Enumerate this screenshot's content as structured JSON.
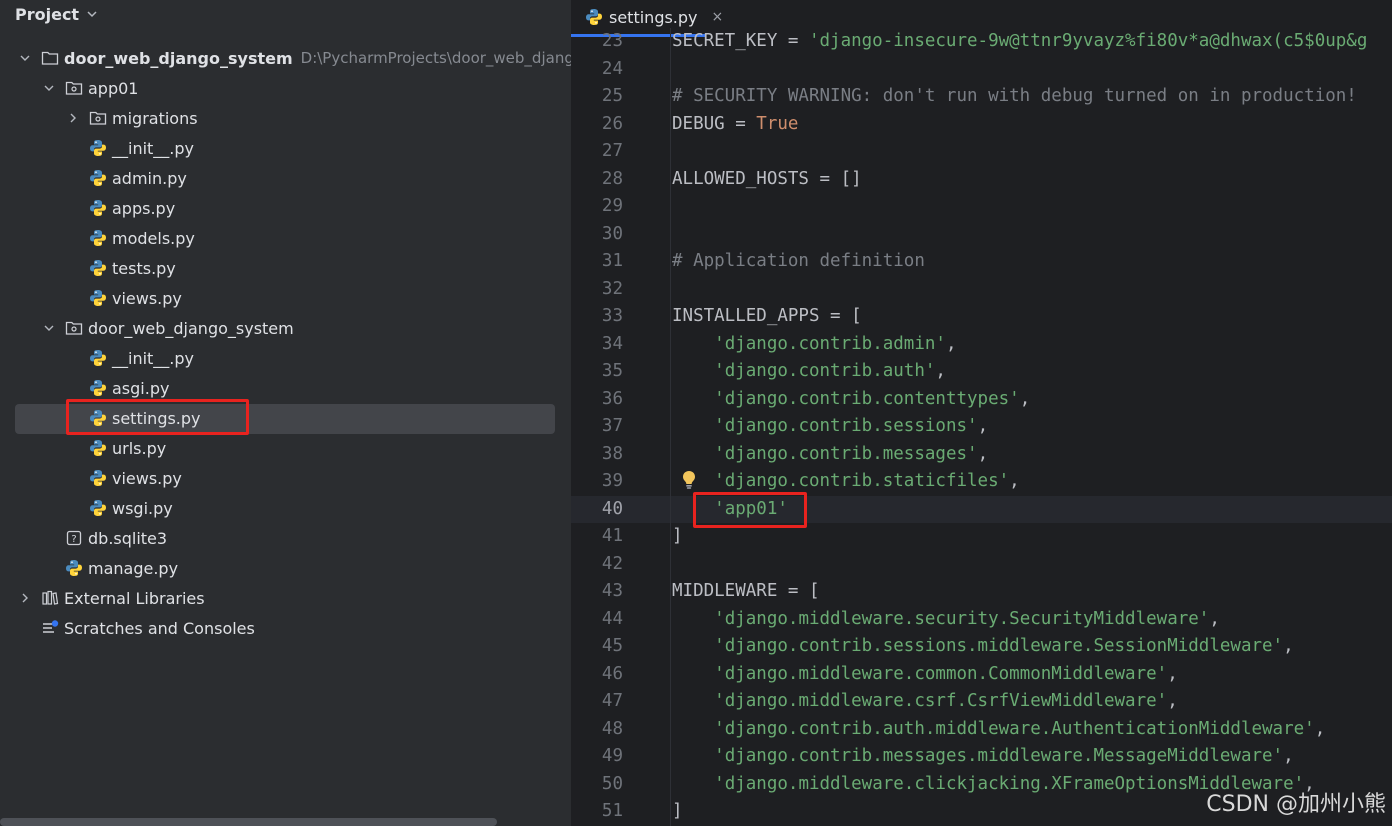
{
  "project_panel": {
    "title": "Project",
    "tree": [
      {
        "label": "door_web_django_system",
        "path": "D:\\PycharmProjects\\door_web_django",
        "icon": "folder-icon",
        "level": 0,
        "expanded": true,
        "bold": true
      },
      {
        "label": "app01",
        "icon": "package-folder-icon",
        "level": 1,
        "expanded": true
      },
      {
        "label": "migrations",
        "icon": "package-folder-icon",
        "level": 2,
        "expanded": false
      },
      {
        "label": "__init__.py",
        "icon": "python-file-icon",
        "level": 2
      },
      {
        "label": "admin.py",
        "icon": "python-file-icon",
        "level": 2
      },
      {
        "label": "apps.py",
        "icon": "python-file-icon",
        "level": 2
      },
      {
        "label": "models.py",
        "icon": "python-file-icon",
        "level": 2
      },
      {
        "label": "tests.py",
        "icon": "python-file-icon",
        "level": 2
      },
      {
        "label": "views.py",
        "icon": "python-file-icon",
        "level": 2
      },
      {
        "label": "door_web_django_system",
        "icon": "package-folder-icon",
        "level": 1,
        "expanded": true
      },
      {
        "label": "__init__.py",
        "icon": "python-file-icon",
        "level": 2
      },
      {
        "label": "asgi.py",
        "icon": "python-file-icon",
        "level": 2
      },
      {
        "label": "settings.py",
        "icon": "python-file-icon",
        "level": 2,
        "selected": true
      },
      {
        "label": "urls.py",
        "icon": "python-file-icon",
        "level": 2
      },
      {
        "label": "views.py",
        "icon": "python-file-icon",
        "level": 2
      },
      {
        "label": "wsgi.py",
        "icon": "python-file-icon",
        "level": 2
      },
      {
        "label": "db.sqlite3",
        "icon": "unknown-file-icon",
        "level": 1
      },
      {
        "label": "manage.py",
        "icon": "python-file-icon",
        "level": 1
      },
      {
        "label": "External Libraries",
        "icon": "library-icon",
        "level": 0,
        "expanded": false
      },
      {
        "label": "Scratches and Consoles",
        "icon": "scratches-icon",
        "level": 0
      }
    ]
  },
  "editor": {
    "tab": {
      "label": "settings.py",
      "close": "×"
    },
    "current_line": 40,
    "lines": [
      {
        "n": "23",
        "t": [
          {
            "c": "SECRET_KEY = "
          },
          {
            "s": "'django-insecure-9w@ttnr9yvayz%fi80v*a@dhwax(c5$0up&g"
          }
        ]
      },
      {
        "n": "24",
        "t": []
      },
      {
        "n": "25",
        "t": [
          {
            "m": "# SECURITY WARNING: don't run with debug turned on in production!"
          }
        ]
      },
      {
        "n": "26",
        "t": [
          {
            "c": "DEBUG = "
          },
          {
            "k": "True"
          }
        ]
      },
      {
        "n": "27",
        "t": []
      },
      {
        "n": "28",
        "t": [
          {
            "c": "ALLOWED_HOSTS = []"
          }
        ]
      },
      {
        "n": "29",
        "t": []
      },
      {
        "n": "30",
        "t": []
      },
      {
        "n": "31",
        "t": [
          {
            "m": "# Application definition"
          }
        ]
      },
      {
        "n": "32",
        "t": []
      },
      {
        "n": "33",
        "t": [
          {
            "c": "INSTALLED_APPS = ["
          }
        ]
      },
      {
        "n": "34",
        "t": [
          {
            "c": "    "
          },
          {
            "s": "'django.contrib.admin'"
          },
          {
            "c": ","
          }
        ]
      },
      {
        "n": "35",
        "t": [
          {
            "c": "    "
          },
          {
            "s": "'django.contrib.auth'"
          },
          {
            "c": ","
          }
        ]
      },
      {
        "n": "36",
        "t": [
          {
            "c": "    "
          },
          {
            "s": "'django.contrib.contenttypes'"
          },
          {
            "c": ","
          }
        ]
      },
      {
        "n": "37",
        "t": [
          {
            "c": "    "
          },
          {
            "s": "'django.contrib.sessions'"
          },
          {
            "c": ","
          }
        ]
      },
      {
        "n": "38",
        "t": [
          {
            "c": "    "
          },
          {
            "s": "'django.contrib.messages'"
          },
          {
            "c": ","
          }
        ]
      },
      {
        "n": "39",
        "t": [
          {
            "c": "    "
          },
          {
            "s": "'django.contrib.staticfiles'"
          },
          {
            "c": ","
          }
        ]
      },
      {
        "n": "40",
        "t": [
          {
            "c": "    "
          },
          {
            "s": "'app01'"
          }
        ]
      },
      {
        "n": "41",
        "t": [
          {
            "c": "]"
          }
        ]
      },
      {
        "n": "42",
        "t": []
      },
      {
        "n": "43",
        "t": [
          {
            "c": "MIDDLEWARE = ["
          }
        ]
      },
      {
        "n": "44",
        "t": [
          {
            "c": "    "
          },
          {
            "s": "'django.middleware.security.SecurityMiddleware'"
          },
          {
            "c": ","
          }
        ]
      },
      {
        "n": "45",
        "t": [
          {
            "c": "    "
          },
          {
            "s": "'django.contrib.sessions.middleware.SessionMiddleware'"
          },
          {
            "c": ","
          }
        ]
      },
      {
        "n": "46",
        "t": [
          {
            "c": "    "
          },
          {
            "s": "'django.middleware.common.CommonMiddleware'"
          },
          {
            "c": ","
          }
        ]
      },
      {
        "n": "47",
        "t": [
          {
            "c": "    "
          },
          {
            "s": "'django.middleware.csrf.CsrfViewMiddleware'"
          },
          {
            "c": ","
          }
        ]
      },
      {
        "n": "48",
        "t": [
          {
            "c": "    "
          },
          {
            "s": "'django.contrib.auth.middleware.AuthenticationMiddleware'"
          },
          {
            "c": ","
          }
        ]
      },
      {
        "n": "49",
        "t": [
          {
            "c": "    "
          },
          {
            "s": "'django.contrib.messages.middleware.MessageMiddleware'"
          },
          {
            "c": ","
          }
        ]
      },
      {
        "n": "50",
        "t": [
          {
            "c": "    "
          },
          {
            "s": "'django.middleware.clickjacking.XFrameOptionsMiddleware'"
          },
          {
            "c": ","
          }
        ]
      },
      {
        "n": "51",
        "t": [
          {
            "c": "]"
          }
        ]
      }
    ]
  },
  "watermark": "CSDN @加州小熊",
  "colors": {
    "annotation_red": "#e8231f",
    "string_green": "#6aab73",
    "keyword_orange": "#cf8e6d",
    "comment_gray": "#7a7e85"
  }
}
